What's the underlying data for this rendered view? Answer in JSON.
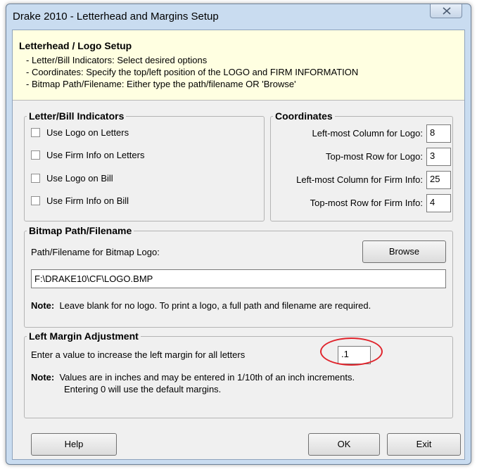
{
  "window": {
    "title": "Drake 2010 - Letterhead and Margins Setup"
  },
  "header": {
    "title": "Letterhead / Logo Setup",
    "lines": [
      "- Letter/Bill Indicators: Select desired options",
      "- Coordinates: Specify the top/left position of the LOGO and FIRM INFORMATION",
      "- Bitmap Path/Filename: Either type the path/filename OR 'Browse'"
    ]
  },
  "indicators": {
    "legend": "Letter/Bill Indicators",
    "options": [
      {
        "label": "Use Logo on Letters",
        "checked": false
      },
      {
        "label": "Use Firm Info on Letters",
        "checked": false
      },
      {
        "label": "Use Logo on Bill",
        "checked": false
      },
      {
        "label": "Use Firm Info on Bill",
        "checked": false
      }
    ]
  },
  "coordinates": {
    "legend": "Coordinates",
    "fields": [
      {
        "label": "Left-most Column for Logo:",
        "value": "8"
      },
      {
        "label": "Top-most Row for Logo:",
        "value": "3"
      },
      {
        "label": "Left-most Column for Firm Info:",
        "value": "25"
      },
      {
        "label": "Top-most Row for Firm Info:",
        "value": "4"
      }
    ]
  },
  "bitmap": {
    "legend": "Bitmap Path/Filename",
    "path_label": "Path/Filename for Bitmap Logo:",
    "browse_label": "Browse",
    "path_value": "F:\\DRAKE10\\CF\\LOGO.BMP",
    "note_bold": "Note:",
    "note_text": "Leave blank for no logo. To print a logo, a full path and filename are required."
  },
  "margin": {
    "legend": "Left Margin Adjustment",
    "prompt": "Enter a value to increase the left margin for all letters",
    "value": ".1",
    "note_bold": "Note:",
    "note_line1": "Values are in inches and may be entered in 1/10th of an inch increments.",
    "note_line2": "Entering 0 will use the default margins."
  },
  "buttons": {
    "help": "Help",
    "ok": "OK",
    "exit": "Exit"
  },
  "annotation": {
    "color": "#e0242c"
  }
}
